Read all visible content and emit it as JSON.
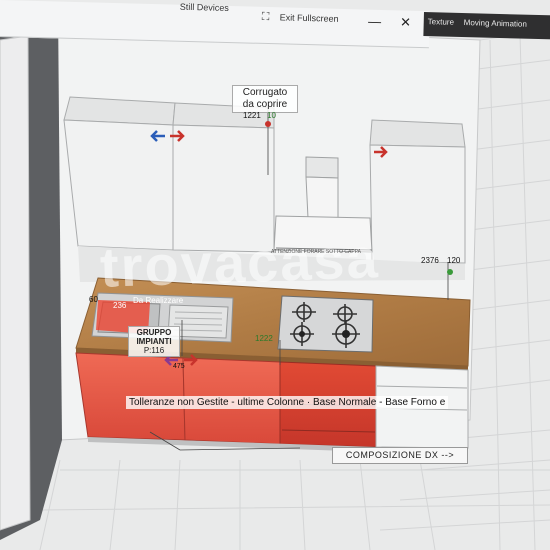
{
  "toolbar": {
    "devices_label": "Still Devices",
    "exit_fullscreen_label": "Exit Fullscreen",
    "minimize_glyph": "—",
    "close_glyph": "✕",
    "texture_label": "Texture",
    "moving_animation_label": "Moving Animation"
  },
  "annotations": {
    "corrugato_line1": "Corrugato",
    "corrugato_line2": "da coprire",
    "corrugato_dim": "1221",
    "corrugato_side": "10",
    "da_realizzare": "Da Realizzare",
    "dim_236": "236",
    "dim_60": "60",
    "gruppo_line1": "GRUPPO",
    "gruppo_line2": "IMPIANTI",
    "gruppo_code": "P:116",
    "dim_2376": "2376",
    "dim_120": "120",
    "dim_475": "475",
    "dim_1222": "1222",
    "hood_note": "ATTENZIONE FORARE SOTTO CAPPA"
  },
  "status": {
    "tolleranze_text": "Tolleranze non Gestite - ultime Colonne · Base Normale - Base Forno e",
    "composizione_label": "COMPOSIZIONE DX -->"
  },
  "watermark": "trovacasa",
  "colors": {
    "red_cabinet": "#e2503f",
    "wood_top": "#b8864e",
    "white_cabinet": "#f1f2f2",
    "arrow_red": "#c8332c",
    "arrow_blue": "#2a5db8"
  }
}
